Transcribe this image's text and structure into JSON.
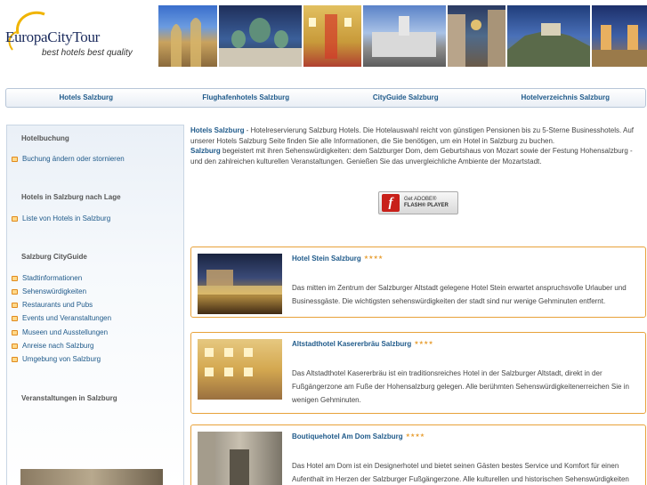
{
  "header": {
    "logo_main": "EuropaCityTour",
    "logo_tagline": "best hotels best quality",
    "photos": [
      "salzburg-churches-photo",
      "salzburg-cathedral-domes-photo",
      "mozart-house-photo",
      "residenzplatz-photo",
      "getreidegasse-photo",
      "festung-hohensalzburg-photo",
      "cathedral-towers-photo"
    ]
  },
  "nav": {
    "items": [
      "Hotels Salzburg",
      "Flughafenhotels Salzburg",
      "CityGuide Salzburg",
      "Hotelverzeichnis Salzburg"
    ]
  },
  "sidebar": {
    "section1": {
      "title": "Hotelbuchung",
      "items": [
        "Buchung ändern oder stornieren"
      ]
    },
    "section2": {
      "title": "Hotels in Salzburg nach Lage",
      "items": [
        "Liste von Hotels in Salzburg"
      ]
    },
    "section3": {
      "title": "Salzburg CityGuide",
      "items": [
        "Stadtinformationen",
        "Sehenswürdigkeiten",
        "Restaurants und Pubs",
        "Events und Veranstaltungen",
        "Museen und Ausstellungen",
        "Anreise nach Salzburg",
        "Umgebung von Salzburg"
      ]
    },
    "section4": {
      "title": "Veranstaltungen in Salzburg"
    }
  },
  "intro": {
    "lead": "Hotels Salzburg",
    "text1": " - Hotelreservierung Salzburg Hotels. Die Hotelauswahl reicht von günstigen Pensionen bis zu 5-Sterne Businesshotels. Auf unserer Hotels Salzburg Seite finden Sie alle Informationen, die Sie benötigen, um ein Hotel in Salzburg zu buchen.",
    "lead2": "Salzburg",
    "text2": " begeistert mit ihren Sehenswürdigkeiten: dem Salzburger Dom, dem Geburtshaus von Mozart sowie der Festung Hohensalzburg - und den zahlreichen kulturellen Veranstaltungen. Genießen Sie das unvergleichliche Ambiente der Mozartstadt."
  },
  "flash": {
    "line1": "Get ADOBE®",
    "line2": "FLASH® PLAYER"
  },
  "hotels": [
    {
      "name": "Hotel Stein Salzburg",
      "stars": "★★★★",
      "desc": "Das mitten im Zentrum der Salzburger Altstadt gelegene Hotel Stein erwartet anspruchsvolle Urlauber und Businessgäste. Die wichtigsten sehenswürdigkeiten der stadt sind nur wenige Gehminuten entfernt."
    },
    {
      "name": "Altstadthotel Kasererbräu Salzburg",
      "stars": "★★★★",
      "desc": "Das Altstadthotel Kasererbräu ist ein traditionsreiches Hotel in der Salzburger Altstadt, direkt in der Fußgängerzone am Fuße der Hohensalzburg gelegen. Alle berühmten Sehenswürdigkeitenerreichen Sie in wenigen Gehminuten."
    },
    {
      "name": "Boutiquehotel Am Dom Salzburg",
      "stars": "★★★★",
      "desc": "Das Hotel am Dom ist ein Designerhotel und bietet seinen Gästen bestes Service und Komfort für einen Aufenthalt im Herzen der Salzburger Fußgängerzone. Alle kulturellen und historischen Sehenswürdigkeiten"
    }
  ],
  "colors": {
    "link": "#1f5a8a",
    "accent": "#e8a23a",
    "border": "#b7c6d8"
  }
}
